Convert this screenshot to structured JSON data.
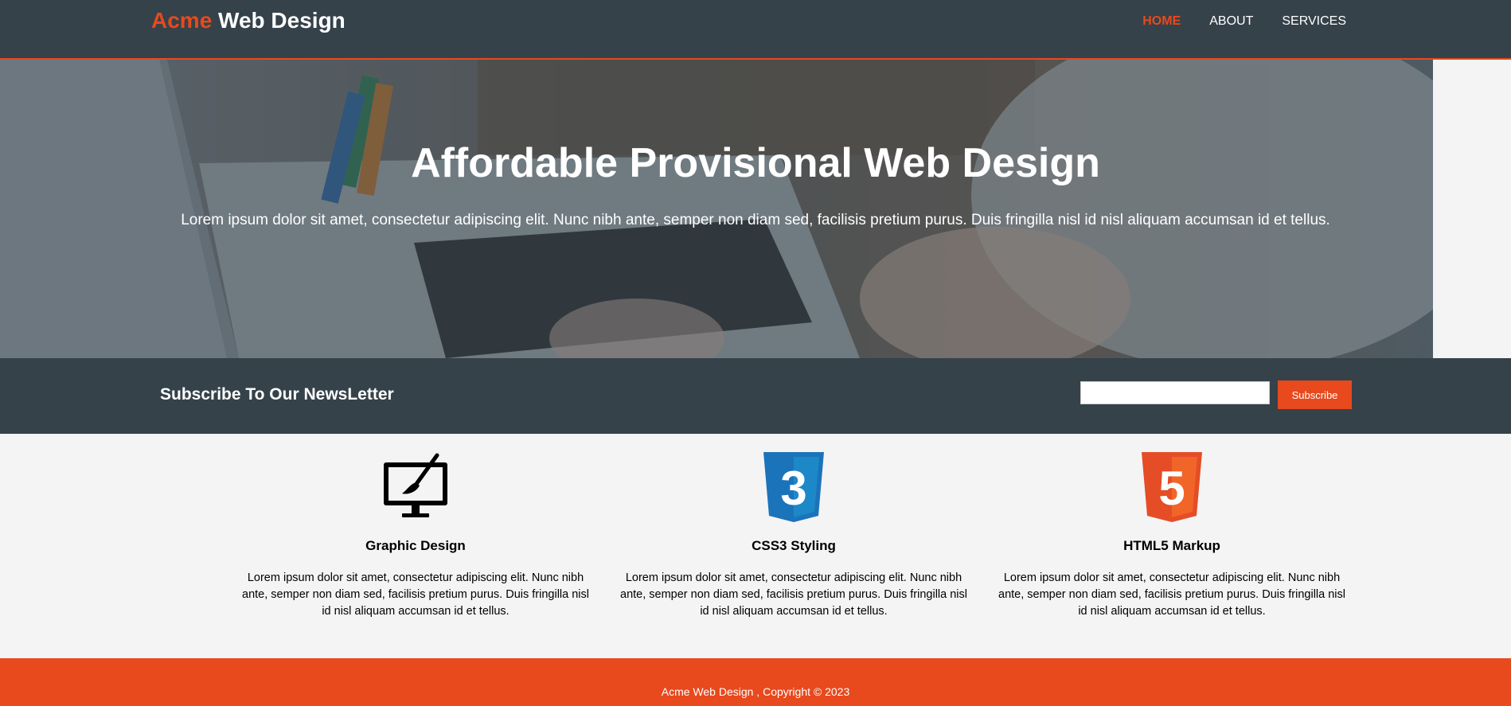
{
  "header": {
    "brand_highlight": "Acme",
    "brand_rest": "Web Design",
    "nav": [
      {
        "label": "HOME",
        "active": true
      },
      {
        "label": "ABOUT",
        "active": false
      },
      {
        "label": "SERVICES",
        "active": false
      }
    ]
  },
  "showcase": {
    "title": "Affordable Provisional Web Design",
    "text": "Lorem ipsum dolor sit amet, consectetur adipiscing elit. Nunc nibh ante, semper non diam sed, facilisis pretium purus. Duis fringilla nisl id nisl aliquam accumsan id et tellus."
  },
  "newsletter": {
    "heading": "Subscribe To Our NewsLetter",
    "email_value": "",
    "email_placeholder": "",
    "button_label": "Subscribe"
  },
  "boxes": [
    {
      "icon": "paint-brush-monitor-icon",
      "title": "Graphic Design",
      "text": "Lorem ipsum dolor sit amet, consectetur adipiscing elit. Nunc nibh ante, semper non diam sed, facilisis pretium purus. Duis fringilla nisl id nisl aliquam accumsan id et tellus."
    },
    {
      "icon": "css3-logo-icon",
      "title": "CSS3 Styling",
      "text": "Lorem ipsum dolor sit amet, consectetur adipiscing elit. Nunc nibh ante, semper non diam sed, facilisis pretium purus. Duis fringilla nisl id nisl aliquam accumsan id et tellus."
    },
    {
      "icon": "html5-logo-icon",
      "title": "HTML5 Markup",
      "text": "Lorem ipsum dolor sit amet, consectetur adipiscing elit. Nunc nibh ante, semper non diam sed, facilisis pretium purus. Duis fringilla nisl id nisl aliquam accumsan id et tellus."
    }
  ],
  "css3_badge": "3",
  "html5_badge": "5",
  "footer": {
    "text": "Acme Web Design , Copyright © 2023"
  },
  "colors": {
    "accent": "#e8491d",
    "dark": "#35424a",
    "light": "#f4f4f4",
    "css3_blue": "#1b73ba",
    "html5_orange": "#e44d26"
  }
}
